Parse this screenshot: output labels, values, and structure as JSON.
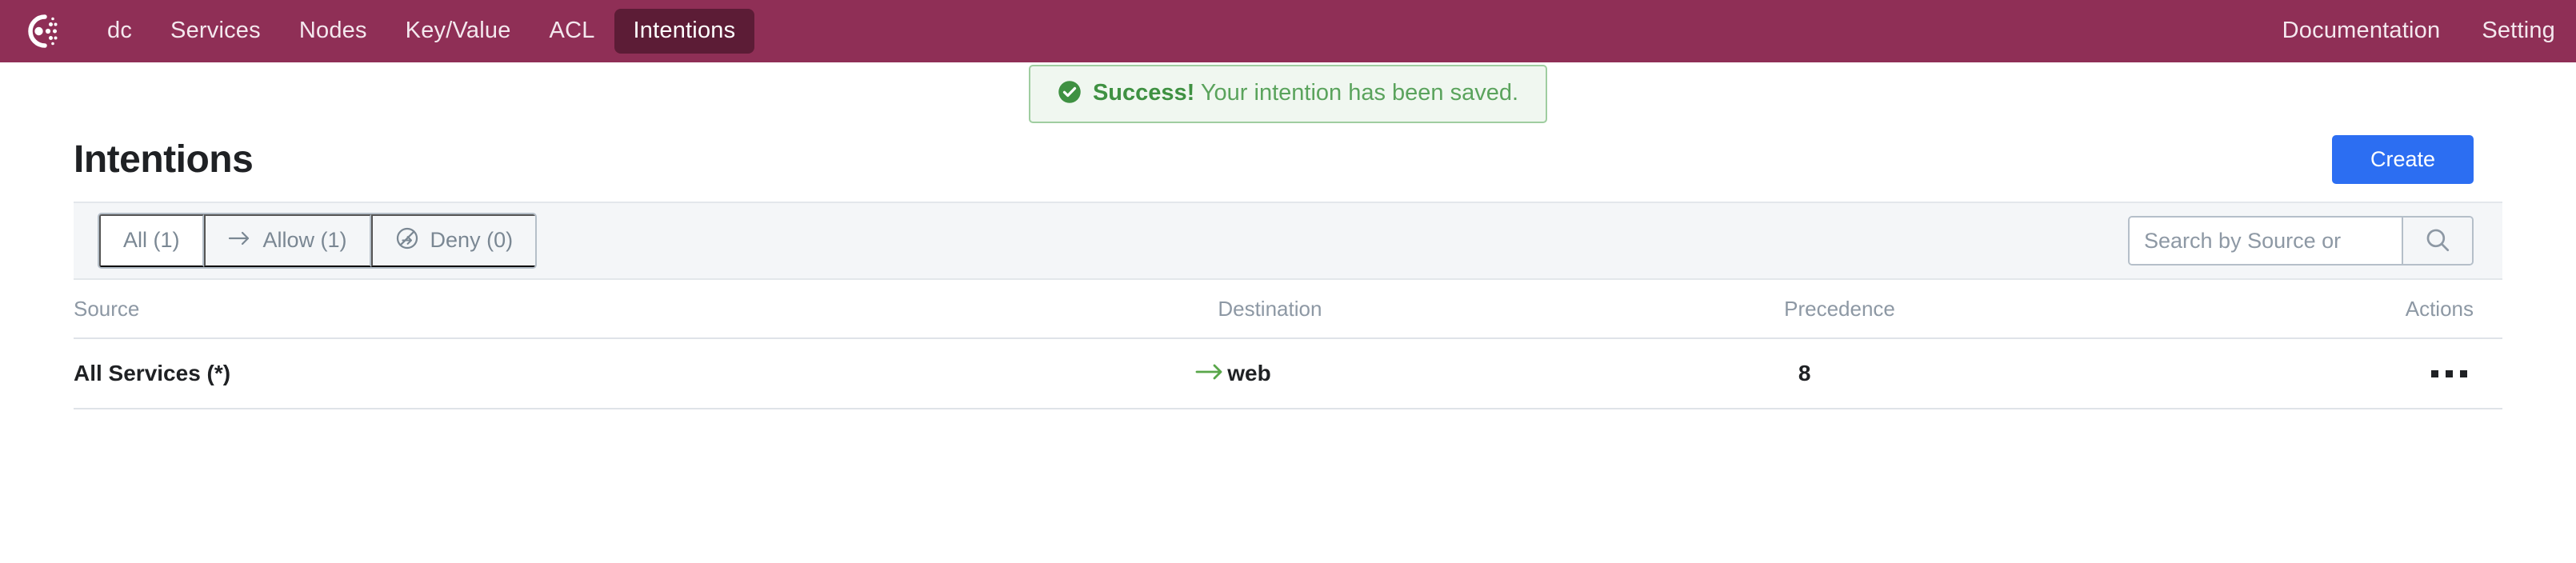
{
  "app": {
    "brand_icon": "consul-logo-icon",
    "nav_bg": "#8f2f56",
    "nav_active_bg": "#5c1c36"
  },
  "navbar": {
    "left_items": [
      {
        "label": "dc",
        "name": "nav-item-dc",
        "active": false
      },
      {
        "label": "Services",
        "name": "nav-item-services",
        "active": false
      },
      {
        "label": "Nodes",
        "name": "nav-item-nodes",
        "active": false
      },
      {
        "label": "Key/Value",
        "name": "nav-item-key-value",
        "active": false
      },
      {
        "label": "ACL",
        "name": "nav-item-acl",
        "active": false
      },
      {
        "label": "Intentions",
        "name": "nav-item-intentions",
        "active": true
      }
    ],
    "right_items": [
      {
        "label": "Documentation",
        "name": "nav-item-documentation"
      },
      {
        "label": "Setting",
        "name": "nav-item-settings"
      }
    ]
  },
  "notification": {
    "icon": "check-circle-icon",
    "title": "Success!",
    "message": "Your intention has been saved.",
    "accent": "#3f9142",
    "bg": "#f0f7f0",
    "border": "#9fcda0"
  },
  "page": {
    "title": "Intentions",
    "create_label": "Create",
    "create_color": "#2c6ef2"
  },
  "toolbar": {
    "filters": [
      {
        "label": "All (1)",
        "name": "filter-tab-all",
        "icon": "none",
        "active": true
      },
      {
        "label": "Allow (1)",
        "name": "filter-tab-allow",
        "icon": "arrow-right-icon",
        "active": false
      },
      {
        "label": "Deny (0)",
        "name": "filter-tab-deny",
        "icon": "deny-circle-icon",
        "active": false
      }
    ],
    "search": {
      "value": "",
      "placeholder": "Search by Source or",
      "icon": "search-icon"
    }
  },
  "table": {
    "columns": [
      {
        "key": "source",
        "label": "Source"
      },
      {
        "key": "destination",
        "label": "Destination"
      },
      {
        "key": "precedence",
        "label": "Precedence"
      },
      {
        "key": "actions",
        "label": "Actions"
      }
    ],
    "rows": [
      {
        "source": "All Services (*)",
        "action_icon": "arrow-right-icon",
        "action_color": "#59a64a",
        "destination": "web",
        "precedence": "8",
        "actions_icon": "kebab-menu-icon"
      }
    ]
  }
}
